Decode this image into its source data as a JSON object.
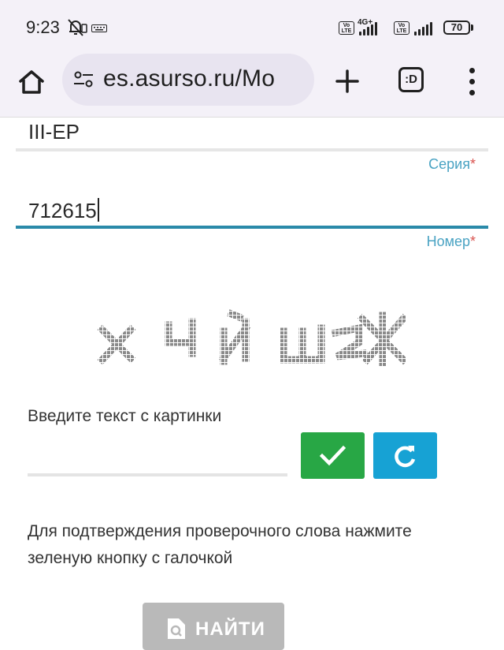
{
  "status_bar": {
    "time": "9:23",
    "network": "4G+",
    "volte": "Vo LTE",
    "battery": "70"
  },
  "browser": {
    "url": "es.asurso.ru/Mo",
    "tabs_label": ":D"
  },
  "form": {
    "series": {
      "value": "III-ЕР",
      "label": "Серия",
      "required_mark": "*"
    },
    "number": {
      "value": "712615",
      "label": "Номер",
      "required_mark": "*"
    },
    "captcha": {
      "image_text": "ХУЙШ2Ж",
      "prompt": "Введите текст с картинки",
      "input_value": ""
    },
    "hint": "Для подтверждения проверочного слова нажмите зеленую кнопку с галочкой",
    "find_button": "НАЙТИ"
  },
  "colors": {
    "accent": "#4aa3c3",
    "required": "#d9534f",
    "confirm": "#28a745",
    "refresh": "#17a2d4",
    "disabled": "#b9b9b9"
  }
}
